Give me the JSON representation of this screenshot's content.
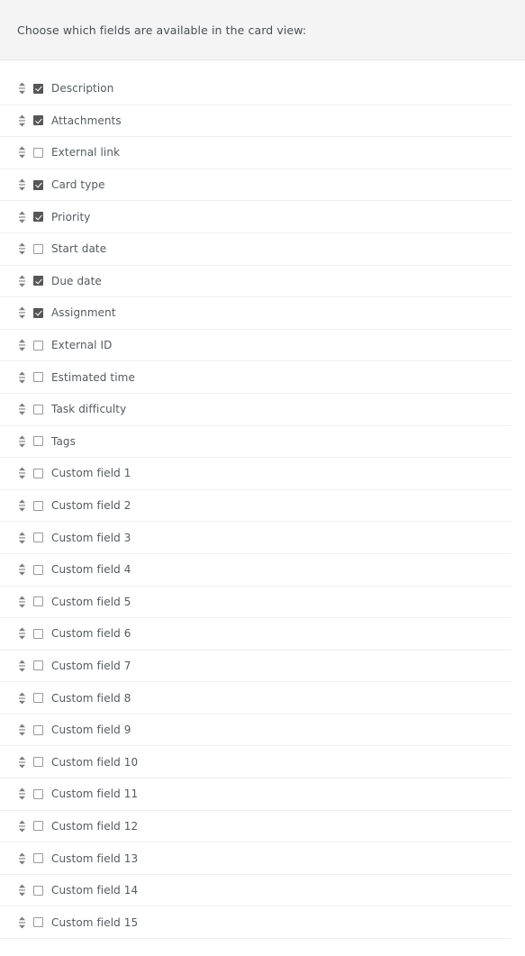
{
  "header": {
    "instruction": "Choose which fields are available in the card view:"
  },
  "colors": {
    "band_background": "#f4f4f4",
    "row_background": "#ffffff",
    "row_divider": "#eeeeee",
    "label_text": "#555a60",
    "checkbox_border": "#9a9a9a",
    "checkbox_checked_fill": "#565656",
    "drag_handle": "#7d7d7d"
  },
  "icons": {
    "drag_handle": "sort-vertical-arrows-icon",
    "checkbox_checked": "checkbox-checked-icon",
    "checkbox_unchecked": "checkbox-unchecked-icon"
  },
  "fields": [
    {
      "label": "Description",
      "checked": true
    },
    {
      "label": "Attachments",
      "checked": true
    },
    {
      "label": "External link",
      "checked": false
    },
    {
      "label": "Card type",
      "checked": true
    },
    {
      "label": "Priority",
      "checked": true
    },
    {
      "label": "Start date",
      "checked": false
    },
    {
      "label": "Due date",
      "checked": true
    },
    {
      "label": "Assignment",
      "checked": true
    },
    {
      "label": "External ID",
      "checked": false
    },
    {
      "label": "Estimated time",
      "checked": false
    },
    {
      "label": "Task difficulty",
      "checked": false
    },
    {
      "label": "Tags",
      "checked": false
    },
    {
      "label": "Custom field 1",
      "checked": false
    },
    {
      "label": "Custom field 2",
      "checked": false
    },
    {
      "label": "Custom field 3",
      "checked": false
    },
    {
      "label": "Custom field 4",
      "checked": false
    },
    {
      "label": "Custom field 5",
      "checked": false
    },
    {
      "label": "Custom field 6",
      "checked": false
    },
    {
      "label": "Custom field 7",
      "checked": false
    },
    {
      "label": "Custom field 8",
      "checked": false
    },
    {
      "label": "Custom field 9",
      "checked": false
    },
    {
      "label": "Custom field 10",
      "checked": false
    },
    {
      "label": "Custom field 11",
      "checked": false
    },
    {
      "label": "Custom field 12",
      "checked": false
    },
    {
      "label": "Custom field 13",
      "checked": false
    },
    {
      "label": "Custom field 14",
      "checked": false
    },
    {
      "label": "Custom field 15",
      "checked": false
    }
  ]
}
